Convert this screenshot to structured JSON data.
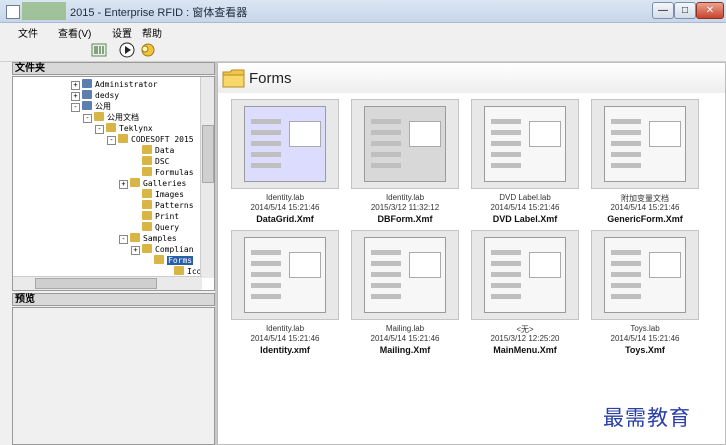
{
  "window": {
    "title": "2015 - Enterprise RFID : 窗体查看器",
    "buttons": [
      "—",
      "□",
      "✕"
    ]
  },
  "menu": [
    "文件",
    "查看(V)",
    "设置",
    "帮助"
  ],
  "toolbar": {
    "icons": [
      "barcode-icon",
      "run-icon",
      "search-icon"
    ]
  },
  "folders_panel": {
    "title": "文件夹",
    "tree": [
      {
        "label": "Administrator",
        "expander": "+"
      },
      {
        "label": "dedsy",
        "expander": "+"
      },
      {
        "label": "公用",
        "expander": "-"
      },
      {
        "label": "公用文档",
        "expander": "-"
      },
      {
        "label": "Teklynx",
        "expander": "-"
      },
      {
        "label": "CODESOFT 2015",
        "expander": "-"
      },
      {
        "label": "Data",
        "expander": ""
      },
      {
        "label": "DSC",
        "expander": ""
      },
      {
        "label": "Formulas",
        "expander": ""
      },
      {
        "label": "Galleries",
        "expander": "+"
      },
      {
        "label": "Images",
        "expander": ""
      },
      {
        "label": "Patterns",
        "expander": ""
      },
      {
        "label": "Print",
        "expander": ""
      },
      {
        "label": "Query",
        "expander": ""
      },
      {
        "label": "Samples",
        "expander": "-"
      },
      {
        "label": "Complian",
        "expander": "+"
      },
      {
        "label": "Forms",
        "expander": "",
        "selected": true
      },
      {
        "label": "Icons",
        "expander": ""
      }
    ]
  },
  "preview_panel": {
    "title": "预览"
  },
  "main": {
    "folder_title": "Forms",
    "files": [
      {
        "label": "Identity.lab",
        "date": "2014/5/14 15:21:46",
        "name": "DataGrid.Xmf",
        "style": "purple"
      },
      {
        "label": "Identity.lab",
        "date": "2015/3/12 11:32:12",
        "name": "DBForm.Xmf",
        "style": "gray"
      },
      {
        "label": "DVD Label.lab",
        "date": "2014/5/14 15:21:46",
        "name": "DVD Label.Xmf",
        "style": "light"
      },
      {
        "label": "附加变量文档",
        "date": "2014/5/14 15:21:46",
        "name": "GenericForm.Xmf",
        "style": "light"
      },
      {
        "label": "Identity.lab",
        "date": "2014/5/14 15:21:46",
        "name": "Identity.xmf",
        "style": "light"
      },
      {
        "label": "Mailing.lab",
        "date": "2014/5/14 15:21:46",
        "name": "Mailing.Xmf",
        "style": "light"
      },
      {
        "label": "<无>",
        "date": "2015/3/12 12:25:20",
        "name": "MainMenu.Xmf",
        "style": "light"
      },
      {
        "label": "Toys.lab",
        "date": "2014/5/14 15:21:46",
        "name": "Toys.Xmf",
        "style": "light"
      }
    ]
  },
  "watermark": "最需教育",
  "colors": {
    "accent": "#2b5ea8",
    "watermark": "#2a3fa8"
  }
}
